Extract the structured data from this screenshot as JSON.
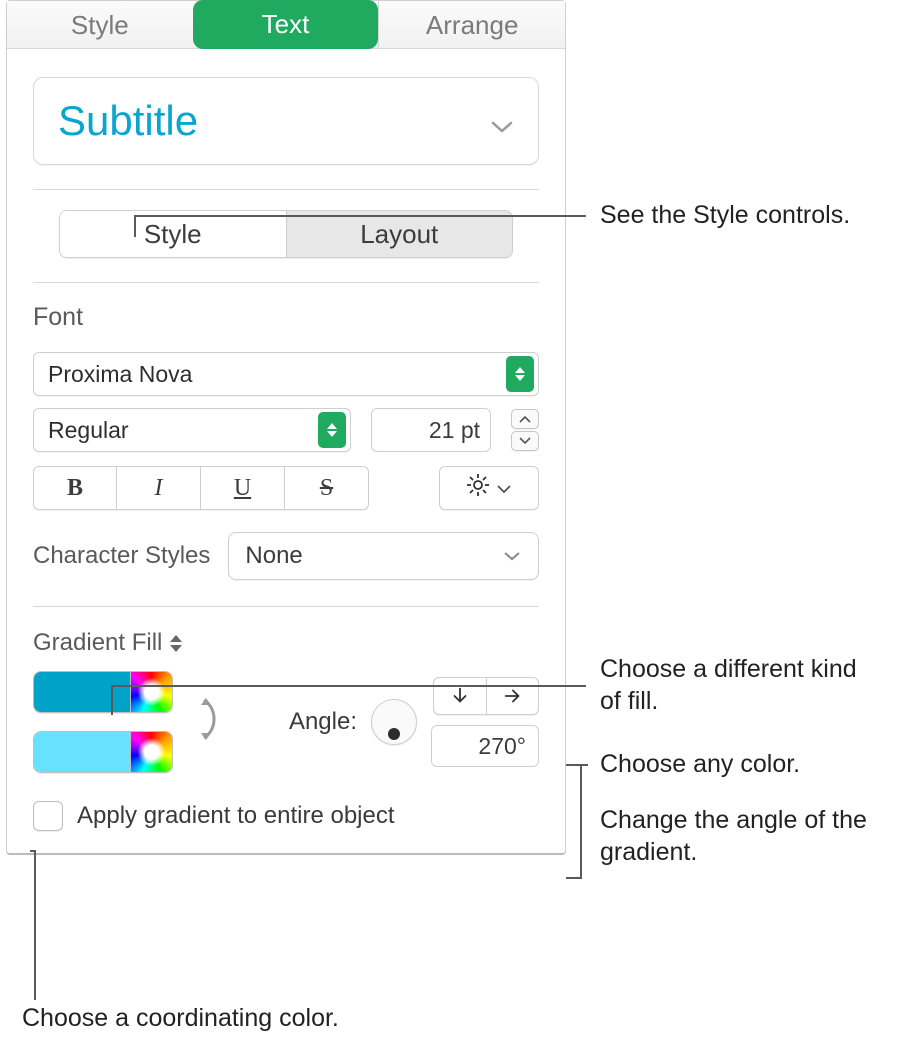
{
  "tabs": {
    "style": "Style",
    "text": "Text",
    "arrange": "Arrange"
  },
  "title_style": "Subtitle",
  "subtabs": {
    "style": "Style",
    "layout": "Layout"
  },
  "font": {
    "heading": "Font",
    "family": "Proxima Nova",
    "weight": "Regular",
    "size": "21 pt",
    "bold": "B",
    "italic": "I",
    "underline": "U",
    "strike": "S"
  },
  "char_styles": {
    "label": "Character Styles",
    "value": "None"
  },
  "fill": {
    "mode": "Gradient Fill",
    "angle_label": "Angle:",
    "angle_value": "270°",
    "color1": "#00A3C7",
    "color2": "#66E2FF",
    "apply_label": "Apply gradient to entire object"
  },
  "annotations": {
    "a1": "See the Style controls.",
    "a2": "Choose a different kind of fill.",
    "a3": "Choose any color.",
    "a4": "Change the angle of the gradient.",
    "a5": "Choose a coordinating color."
  }
}
